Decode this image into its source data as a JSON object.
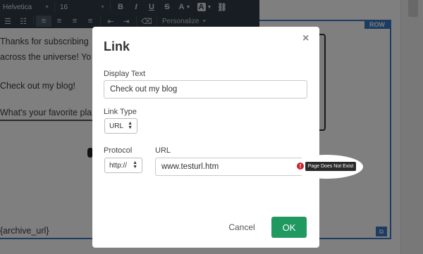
{
  "toolbar": {
    "font_family": "Helvetica",
    "font_size": "16",
    "personalize_label": "Personalize"
  },
  "background": {
    "row_badge": "ROW",
    "lines": [
      "Thanks for subscribing",
      "across the universe! Yo",
      "Check out my blog!",
      "What's your favorite pla",
      "{archive_url}"
    ]
  },
  "modal": {
    "title": "Link",
    "close_glyph": "×",
    "display_text_label": "Display Text",
    "display_text_value": "Check out my blog",
    "link_type_label": "Link Type",
    "link_type_value": "URL",
    "protocol_label": "Protocol",
    "protocol_value": "http://",
    "url_label": "URL",
    "url_value": "www.testurl.htm",
    "error_tooltip": "Page Does Not Exist",
    "cancel_label": "Cancel",
    "ok_label": "OK"
  }
}
